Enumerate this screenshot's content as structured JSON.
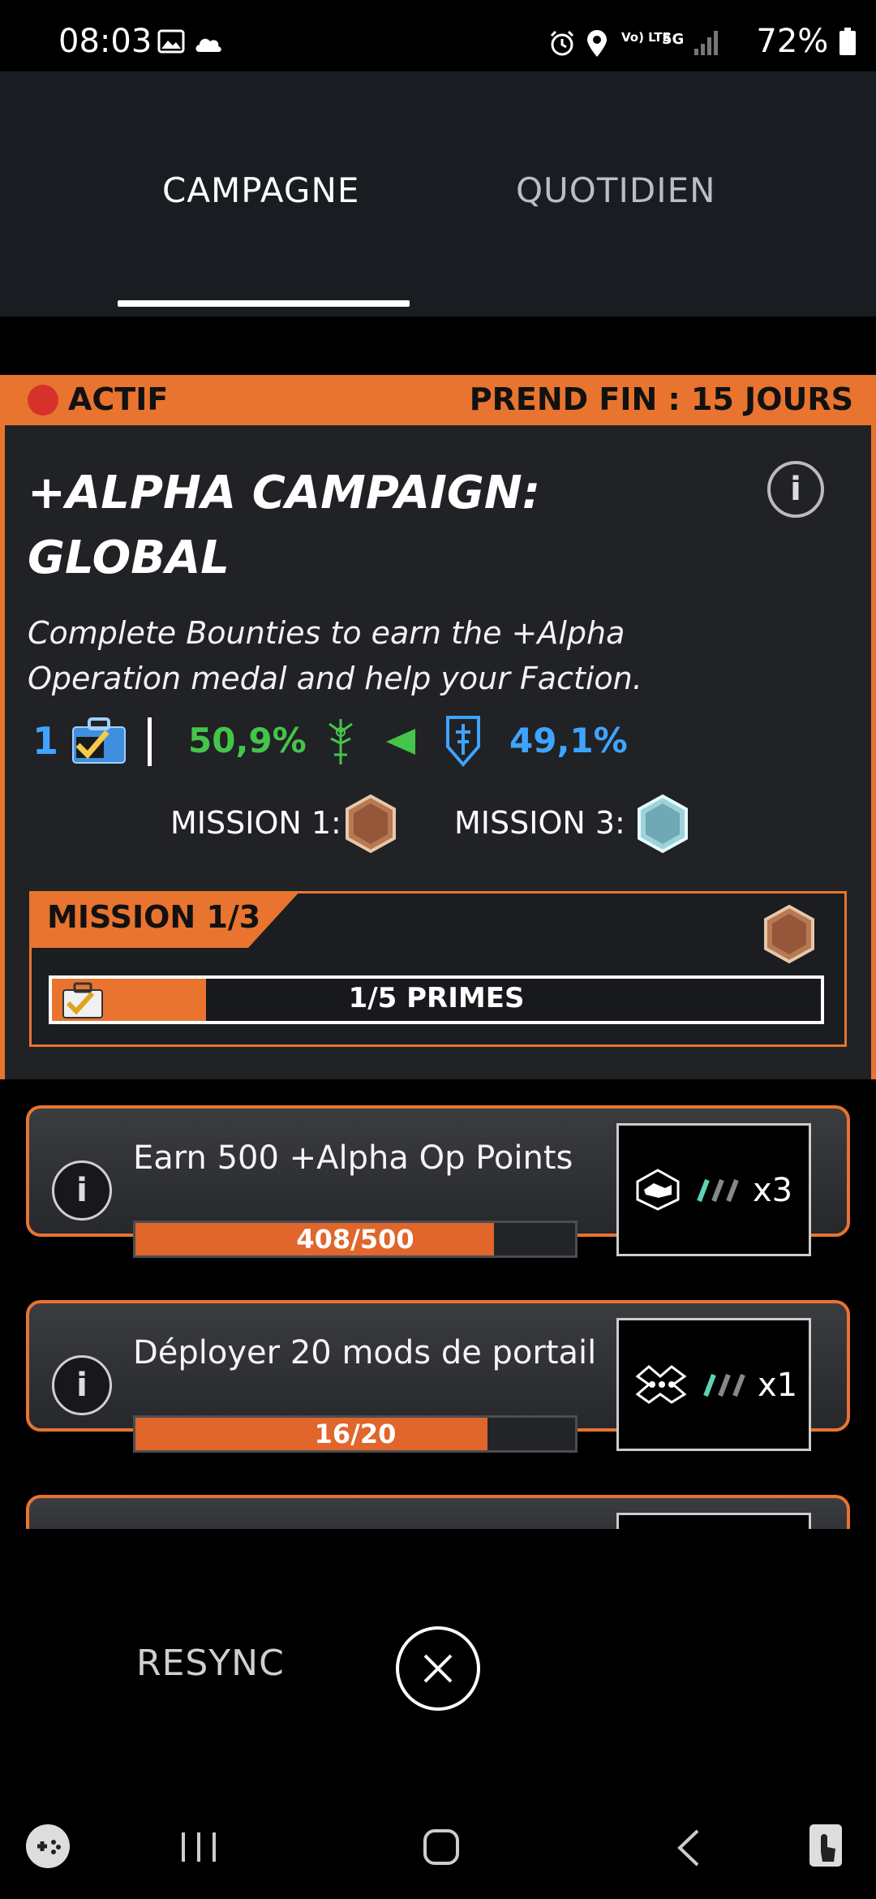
{
  "status_bar": {
    "time": "08:03",
    "battery": "72%",
    "network": "5G",
    "volte": "Vo) LTE"
  },
  "tabs": [
    {
      "label": "CAMPAGNE",
      "active": true
    },
    {
      "label": "QUOTIDIEN",
      "active": false
    }
  ],
  "campaign": {
    "status": "ACTIF",
    "ends": "PREND FIN : 15 JOURS",
    "title_line1": "+ALPHA CAMPAIGN:",
    "title_line2": "GLOBAL",
    "description_line1": "Complete Bounties to earn the +Alpha",
    "description_line2": "Operation medal and help your Faction.",
    "bounty_count": "1",
    "enlightened_percent": "50,9%",
    "resistance_percent": "49,1%",
    "mission1_label": "MISSION 1:",
    "mission3_label": "MISSION 3:",
    "accent_color": "#e8742f"
  },
  "mission": {
    "label": "MISSION 1/3",
    "progress_text": "1/5 PRIMES",
    "progress_fraction": 0.2
  },
  "quests": [
    {
      "title": "Earn 500 +Alpha Op Points",
      "progress": "408/500",
      "fraction": 0.816,
      "reward_mult": "x3"
    },
    {
      "title": "Déployer 20 mods de portail",
      "progress": "16/20",
      "fraction": 0.8,
      "reward_mult": "x1"
    }
  ],
  "footer": {
    "resync": "RESYNC"
  }
}
